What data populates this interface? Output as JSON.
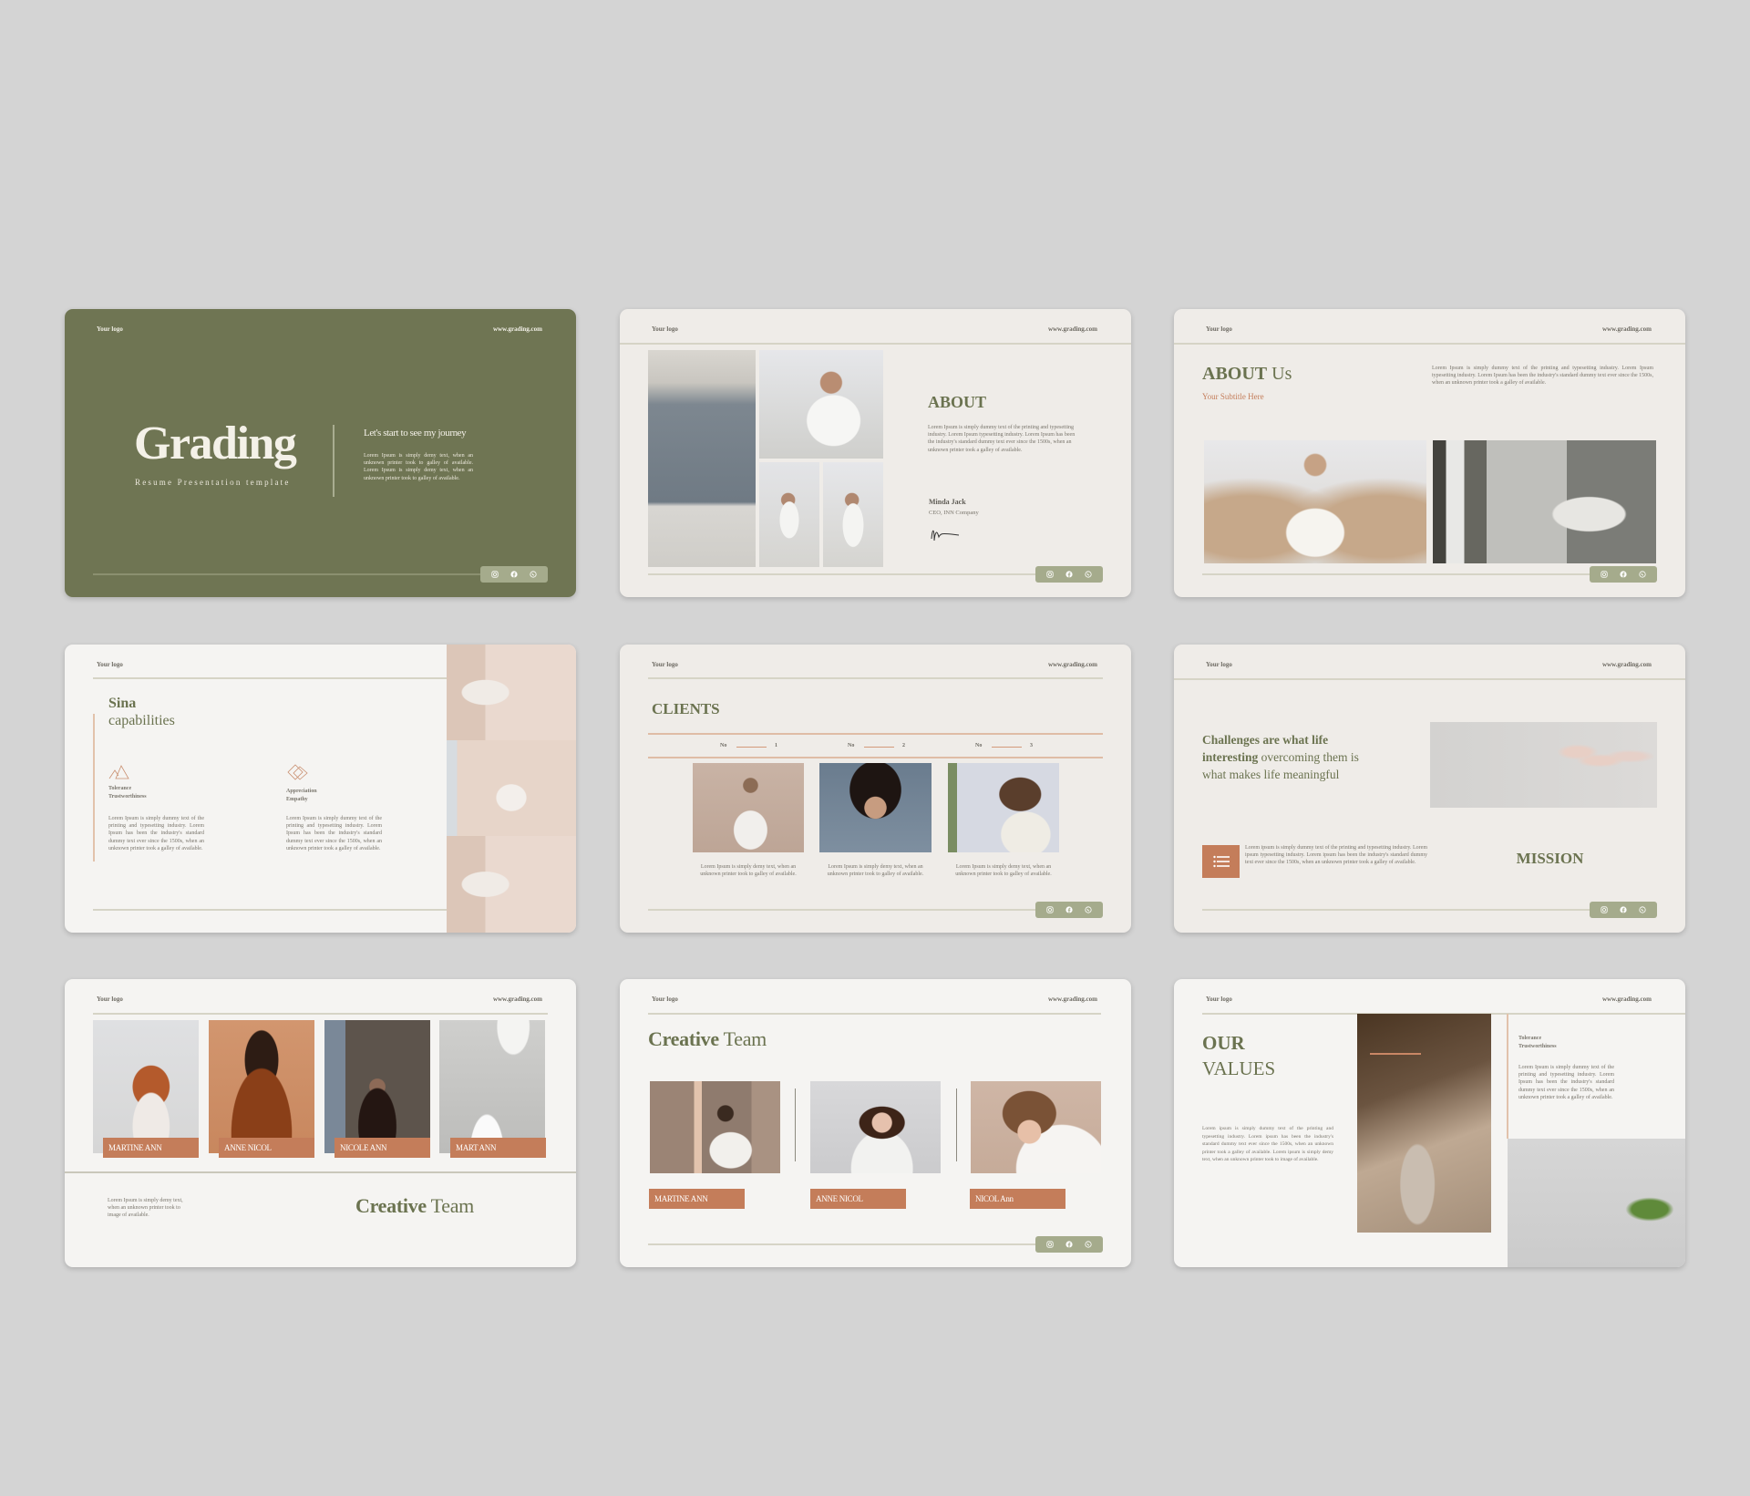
{
  "header": {
    "logo": "Your logo",
    "url": "www.grading.com"
  },
  "social_icons": [
    "instagram-icon",
    "facebook-icon",
    "whatsapp-icon"
  ],
  "colors": {
    "olive": "#6f7553",
    "accent": "#c47d5a",
    "background": "#d4d4d4",
    "slide": "#efece8",
    "pill": "#a5ab8c"
  },
  "slides": {
    "cover": {
      "title": "Grading",
      "subtitle": "Resume Presentation template",
      "tagline": "Let's start to see my journey",
      "body": "Lorem Ipsum is simply demy text, when an unknown printer took to galley of available. Lorem Ipsum is simply demy text, when an unknown printer took to galley of available."
    },
    "about": {
      "title": "ABOUT",
      "body": "Lorem Ipsum is simply dummy text of the printing and typesetting industry. Lorem Ipsum typesetting industry. Lorem Ipsum has been the industry's standard dummy text ever since the 1500s, when an unknown printer took a galley of available.",
      "name": "Minda Jack",
      "role": "CEO, INN Company"
    },
    "about_us": {
      "title_bold": "ABOUT",
      "title_light": "Us",
      "subtitle": "Your Subtitle Here",
      "body": "Lorem Ipsum is simply dummy text of the printing and typesetting industry. Lorem Ipsum typesetting industry. Lorem Ipsum has been the industry's standard dummy text ever since the 1500s, when an unknown printer took a galley of available."
    },
    "capabilities": {
      "title_bold": "Sina",
      "title_light": "capabilities",
      "items": [
        {
          "line1": "Tolerance",
          "line2": "Trustworthiness",
          "icon": "triangles-icon",
          "body": "Lorem Ipsum is simply dummy text of the printing and typesetting industry. Lorem Ipsum has been the industry's standard dummy text ever since the 1500s, when an unknown printer took a galley of available."
        },
        {
          "line1": "Appreciation",
          "line2": "Empathy",
          "icon": "diamonds-icon",
          "body": "Lorem Ipsum is simply dummy text of the printing and typesetting industry. Lorem Ipsum has been the industry's standard dummy text ever since the 1500s, when an unknown printer took a galley of available."
        }
      ]
    },
    "clients": {
      "title": "CLIENTS",
      "items": [
        {
          "label": "No",
          "number": "1",
          "caption": "Lorem Ipsum is simply demy text, when an unknown printer took to galley of available."
        },
        {
          "label": "No",
          "number": "2",
          "caption": "Lorem Ipsum is simply demy text, when an unknown printer took to galley of available."
        },
        {
          "label": "No",
          "number": "3",
          "caption": "Lorem Ipsum is simply demy text, when an unknown printer took to galley of available."
        }
      ]
    },
    "mission": {
      "quote_bold": "Challenges are what life interesting",
      "quote_light": " overcoming them is what makes life meaningful",
      "body": "Lorem ipsum is simply dummy text of the printing and typesetting industry. Lorem ipsum typesetting industry. Lorem ipsum has been the industry's standard dummy text ever since the 1500s, when an unknown printer took a galley of available.",
      "title": "MISSION"
    },
    "team_grid": {
      "members": [
        "MARTINE ANN",
        "ANNE NICOL",
        "NICOLE ANN",
        "MART ANN"
      ],
      "body": "Lorem Ipsum is simply demy text, when an unknown printer took to image of available.",
      "title_bold": "Creative",
      "title_light": "Team"
    },
    "team_row": {
      "title_bold": "Creative",
      "title_light": "Team",
      "members": [
        "MARTINE ANN",
        "ANNE NICOL",
        "NICOL Ann"
      ]
    },
    "values": {
      "title_line1": "OUR",
      "title_line2": "VALUES",
      "body": "Lorem ipsum is simply dummy text of the printing and typesetting industry. Lorem ipsum has been the industry's standard dummy text ever since the 1500s, when an unknown printer took a galley of available. Lorem ipsum is simply demy text, when an unknown printer took to image of available.",
      "side_line1": "Tolerance",
      "side_line2": "Trustworthiness",
      "side_body": "Lorem Ipsum is simply dummy text of the printing and typesetting industry. Lorem Ipsum has been the industry's standard dummy text ever since the 1500s, when an unknown printer took a galley of available."
    }
  }
}
